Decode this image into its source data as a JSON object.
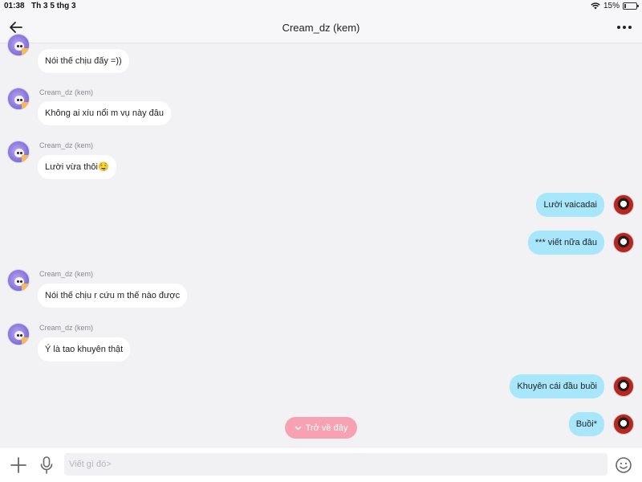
{
  "status": {
    "time": "01:38",
    "date": "Th 3 5 thg 3",
    "battery": "15%",
    "battery_level": 0.15
  },
  "header": {
    "title": "Cream_dz (kem)"
  },
  "messages": [
    {
      "side": "left",
      "sender": "",
      "text": "Nói thế chịu đấy =))"
    },
    {
      "side": "left",
      "sender": "Cream_dz (kem)",
      "text": "Không ai xíu nổi m vụ này đâu"
    },
    {
      "side": "left",
      "sender": "Cream_dz (kem)",
      "text": "Lười vừa thôi🤤"
    },
    {
      "side": "right",
      "text": "Lười vaicadai"
    },
    {
      "side": "right",
      "text": "*** viết nữa đâu"
    },
    {
      "side": "left",
      "sender": "Cream_dz (kem)",
      "text": "Nói thế chịu r cứu m thế nào được"
    },
    {
      "side": "left",
      "sender": "Cream_dz (kem)",
      "text": "Ý là tao khuyên thật"
    },
    {
      "side": "right",
      "text": "Khuyên cái đầu buồi"
    },
    {
      "side": "right",
      "text": "Buồi*"
    }
  ],
  "return_pill": {
    "label": "Trở về đây"
  },
  "input": {
    "placeholder": "Viết gì đó>"
  }
}
